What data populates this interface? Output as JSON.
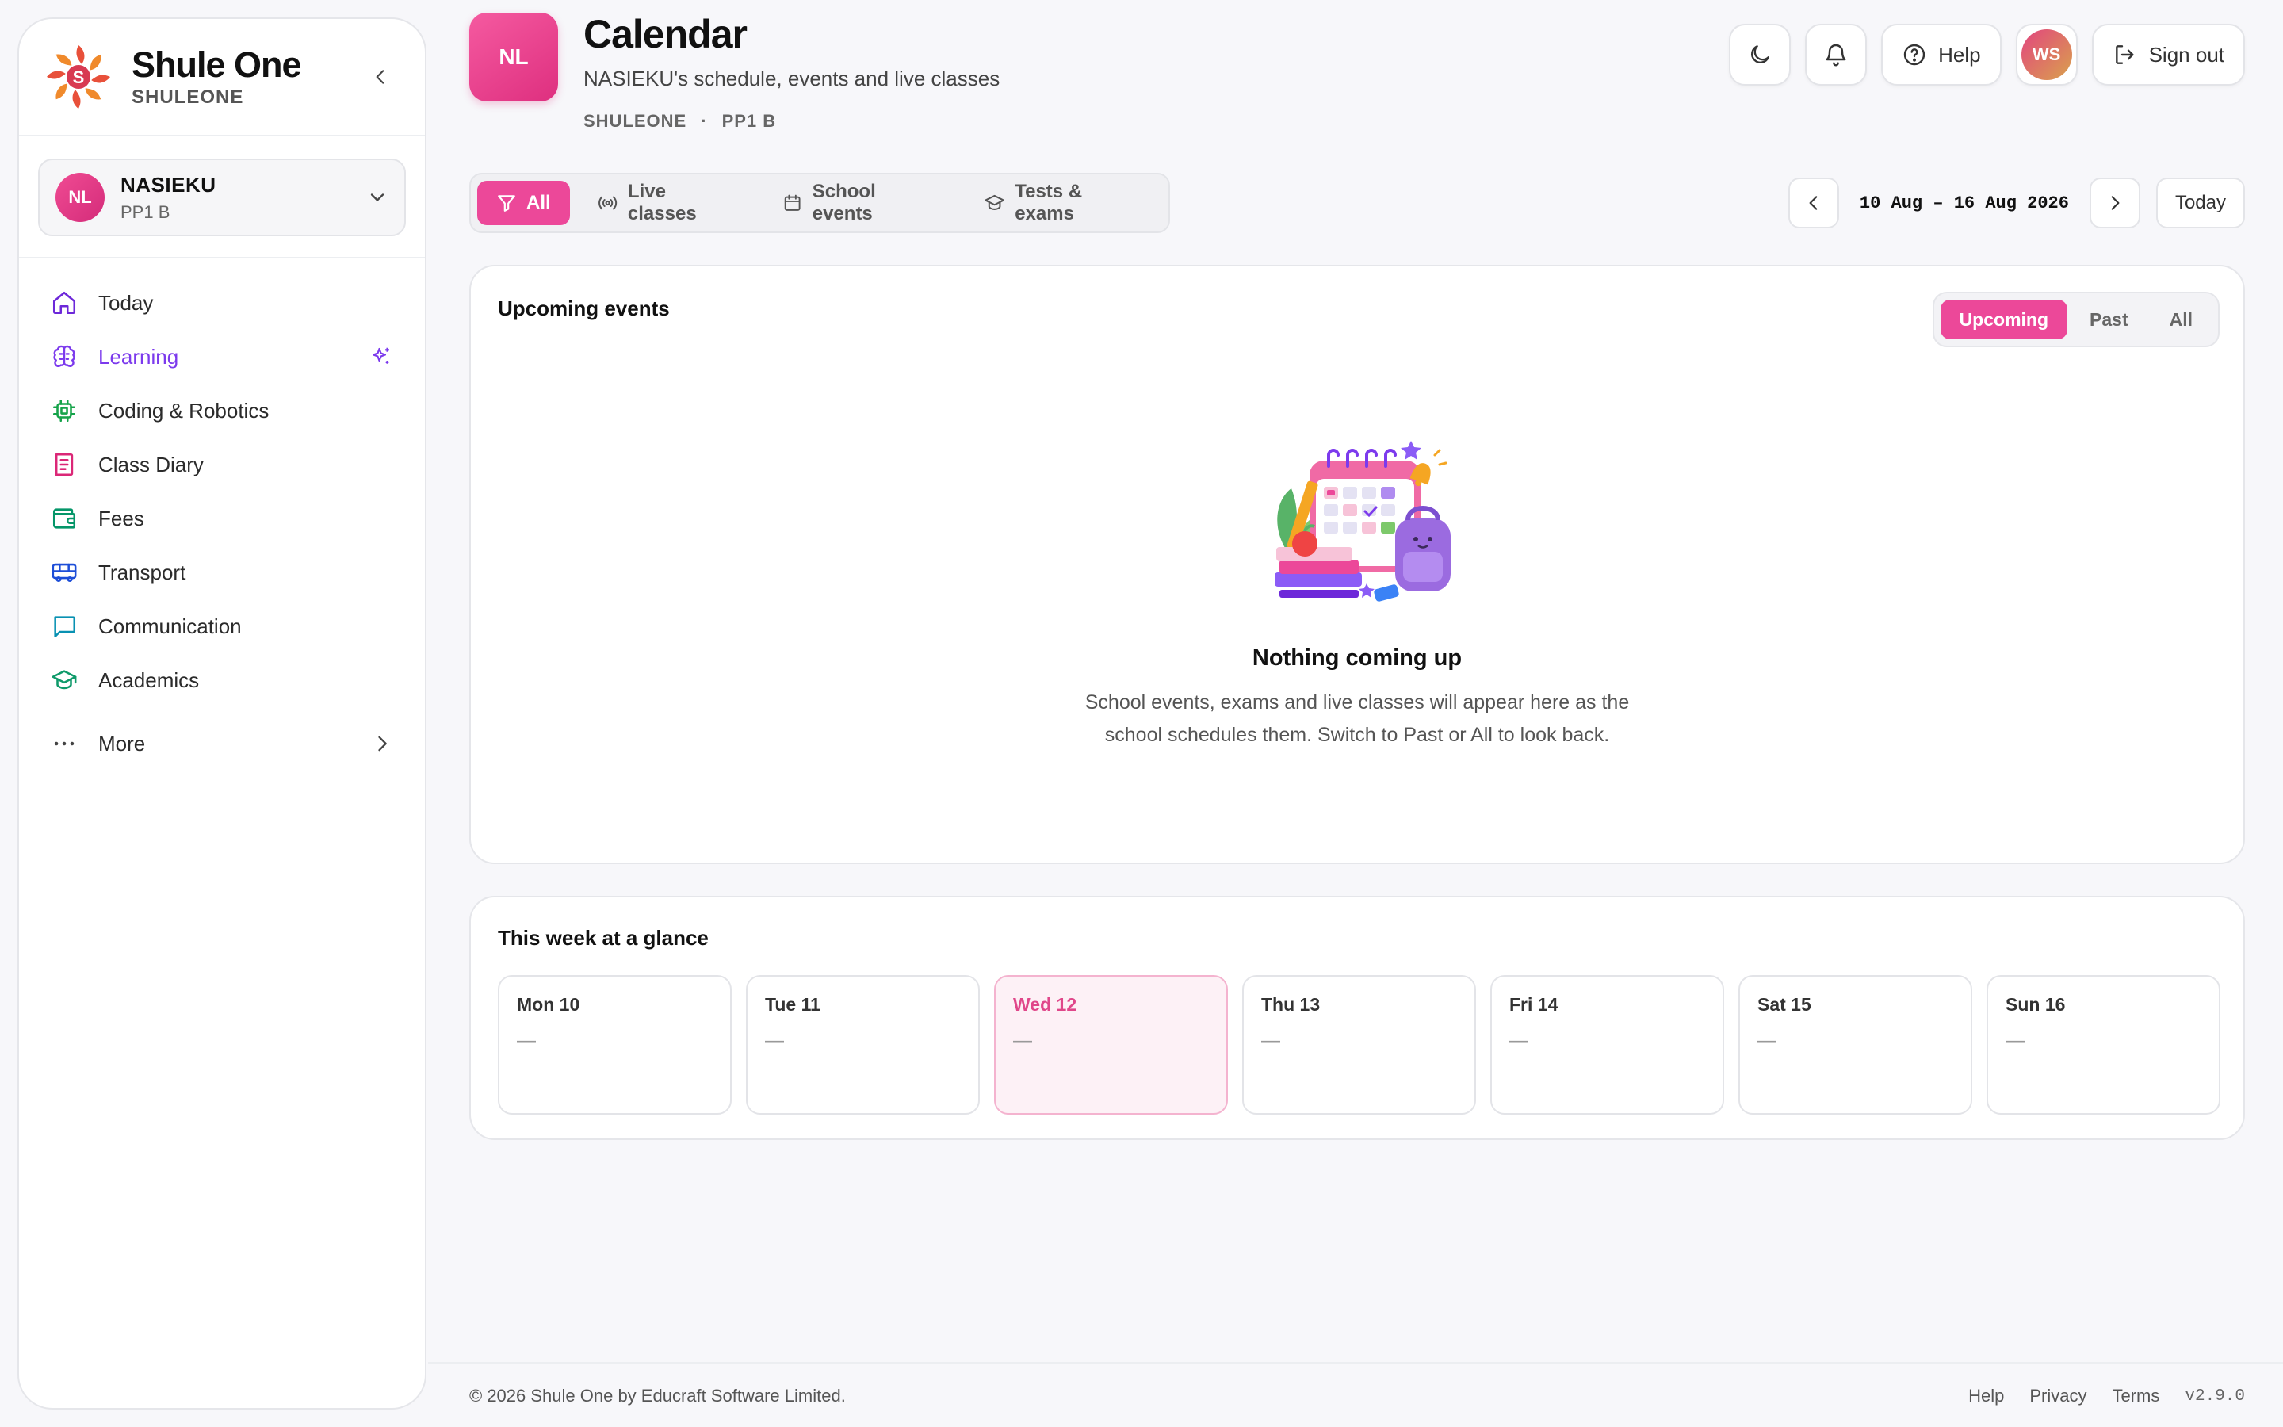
{
  "brand": {
    "name": "Shule One",
    "sub": "SHULEONE"
  },
  "student": {
    "initials": "NL",
    "name": "NASIEKU",
    "class": "PP1 B"
  },
  "nav": {
    "items": [
      {
        "label": "Today",
        "icon": "home-icon",
        "color": "#6d28d9"
      },
      {
        "label": "Learning",
        "icon": "brain-icon",
        "color": "#7c3aed",
        "active": true
      },
      {
        "label": "Coding & Robotics",
        "icon": "chip-icon",
        "color": "#16a34a"
      },
      {
        "label": "Class Diary",
        "icon": "book-icon",
        "color": "#db2777"
      },
      {
        "label": "Fees",
        "icon": "wallet-icon",
        "color": "#059669"
      },
      {
        "label": "Transport",
        "icon": "bus-icon",
        "color": "#1d4ed8"
      },
      {
        "label": "Communication",
        "icon": "message-icon",
        "color": "#0891b2"
      },
      {
        "label": "Academics",
        "icon": "graduation-cap-icon",
        "color": "#0f9a6a"
      }
    ],
    "more_label": "More"
  },
  "header": {
    "initials": "NL",
    "title": "Calendar",
    "subtitle": "NASIEKU's schedule, events and live classes",
    "meta": [
      "SHULEONE",
      "·",
      "PP1 B"
    ]
  },
  "top_actions": {
    "help_label": "Help",
    "user_initials": "WS",
    "signout_label": "Sign out"
  },
  "filters": {
    "tabs": [
      {
        "label": "All",
        "icon": "filter-icon",
        "active": true
      },
      {
        "label": "Live classes",
        "icon": "broadcast-icon"
      },
      {
        "label": "School events",
        "icon": "calendar-icon"
      },
      {
        "label": "Tests & exams",
        "icon": "graduation-cap-icon"
      }
    ]
  },
  "date_nav": {
    "range": "10 Aug – 16 Aug 2026",
    "today_label": "Today"
  },
  "upcoming": {
    "title": "Upcoming events",
    "segments": [
      {
        "label": "Upcoming",
        "active": true
      },
      {
        "label": "Past"
      },
      {
        "label": "All"
      }
    ],
    "empty_title": "Nothing coming up",
    "empty_line1": "School events, exams and live classes will appear here as the",
    "empty_line2": "school schedules them. Switch to Past or All to look back."
  },
  "week": {
    "title": "This week at a glance",
    "days": [
      {
        "label": "Mon 10",
        "value": "—"
      },
      {
        "label": "Tue 11",
        "value": "—"
      },
      {
        "label": "Wed 12",
        "value": "—",
        "today": true
      },
      {
        "label": "Thu 13",
        "value": "—"
      },
      {
        "label": "Fri 14",
        "value": "—"
      },
      {
        "label": "Sat 15",
        "value": "—"
      },
      {
        "label": "Sun 16",
        "value": "—"
      }
    ]
  },
  "footer": {
    "copyright": "© 2026 Shule One by Educraft Software Limited.",
    "links": [
      "Help",
      "Privacy",
      "Terms"
    ],
    "version": "v2.9.0"
  },
  "colors": {
    "accent": "#ec4899",
    "active_nav": "#7c3aed"
  }
}
